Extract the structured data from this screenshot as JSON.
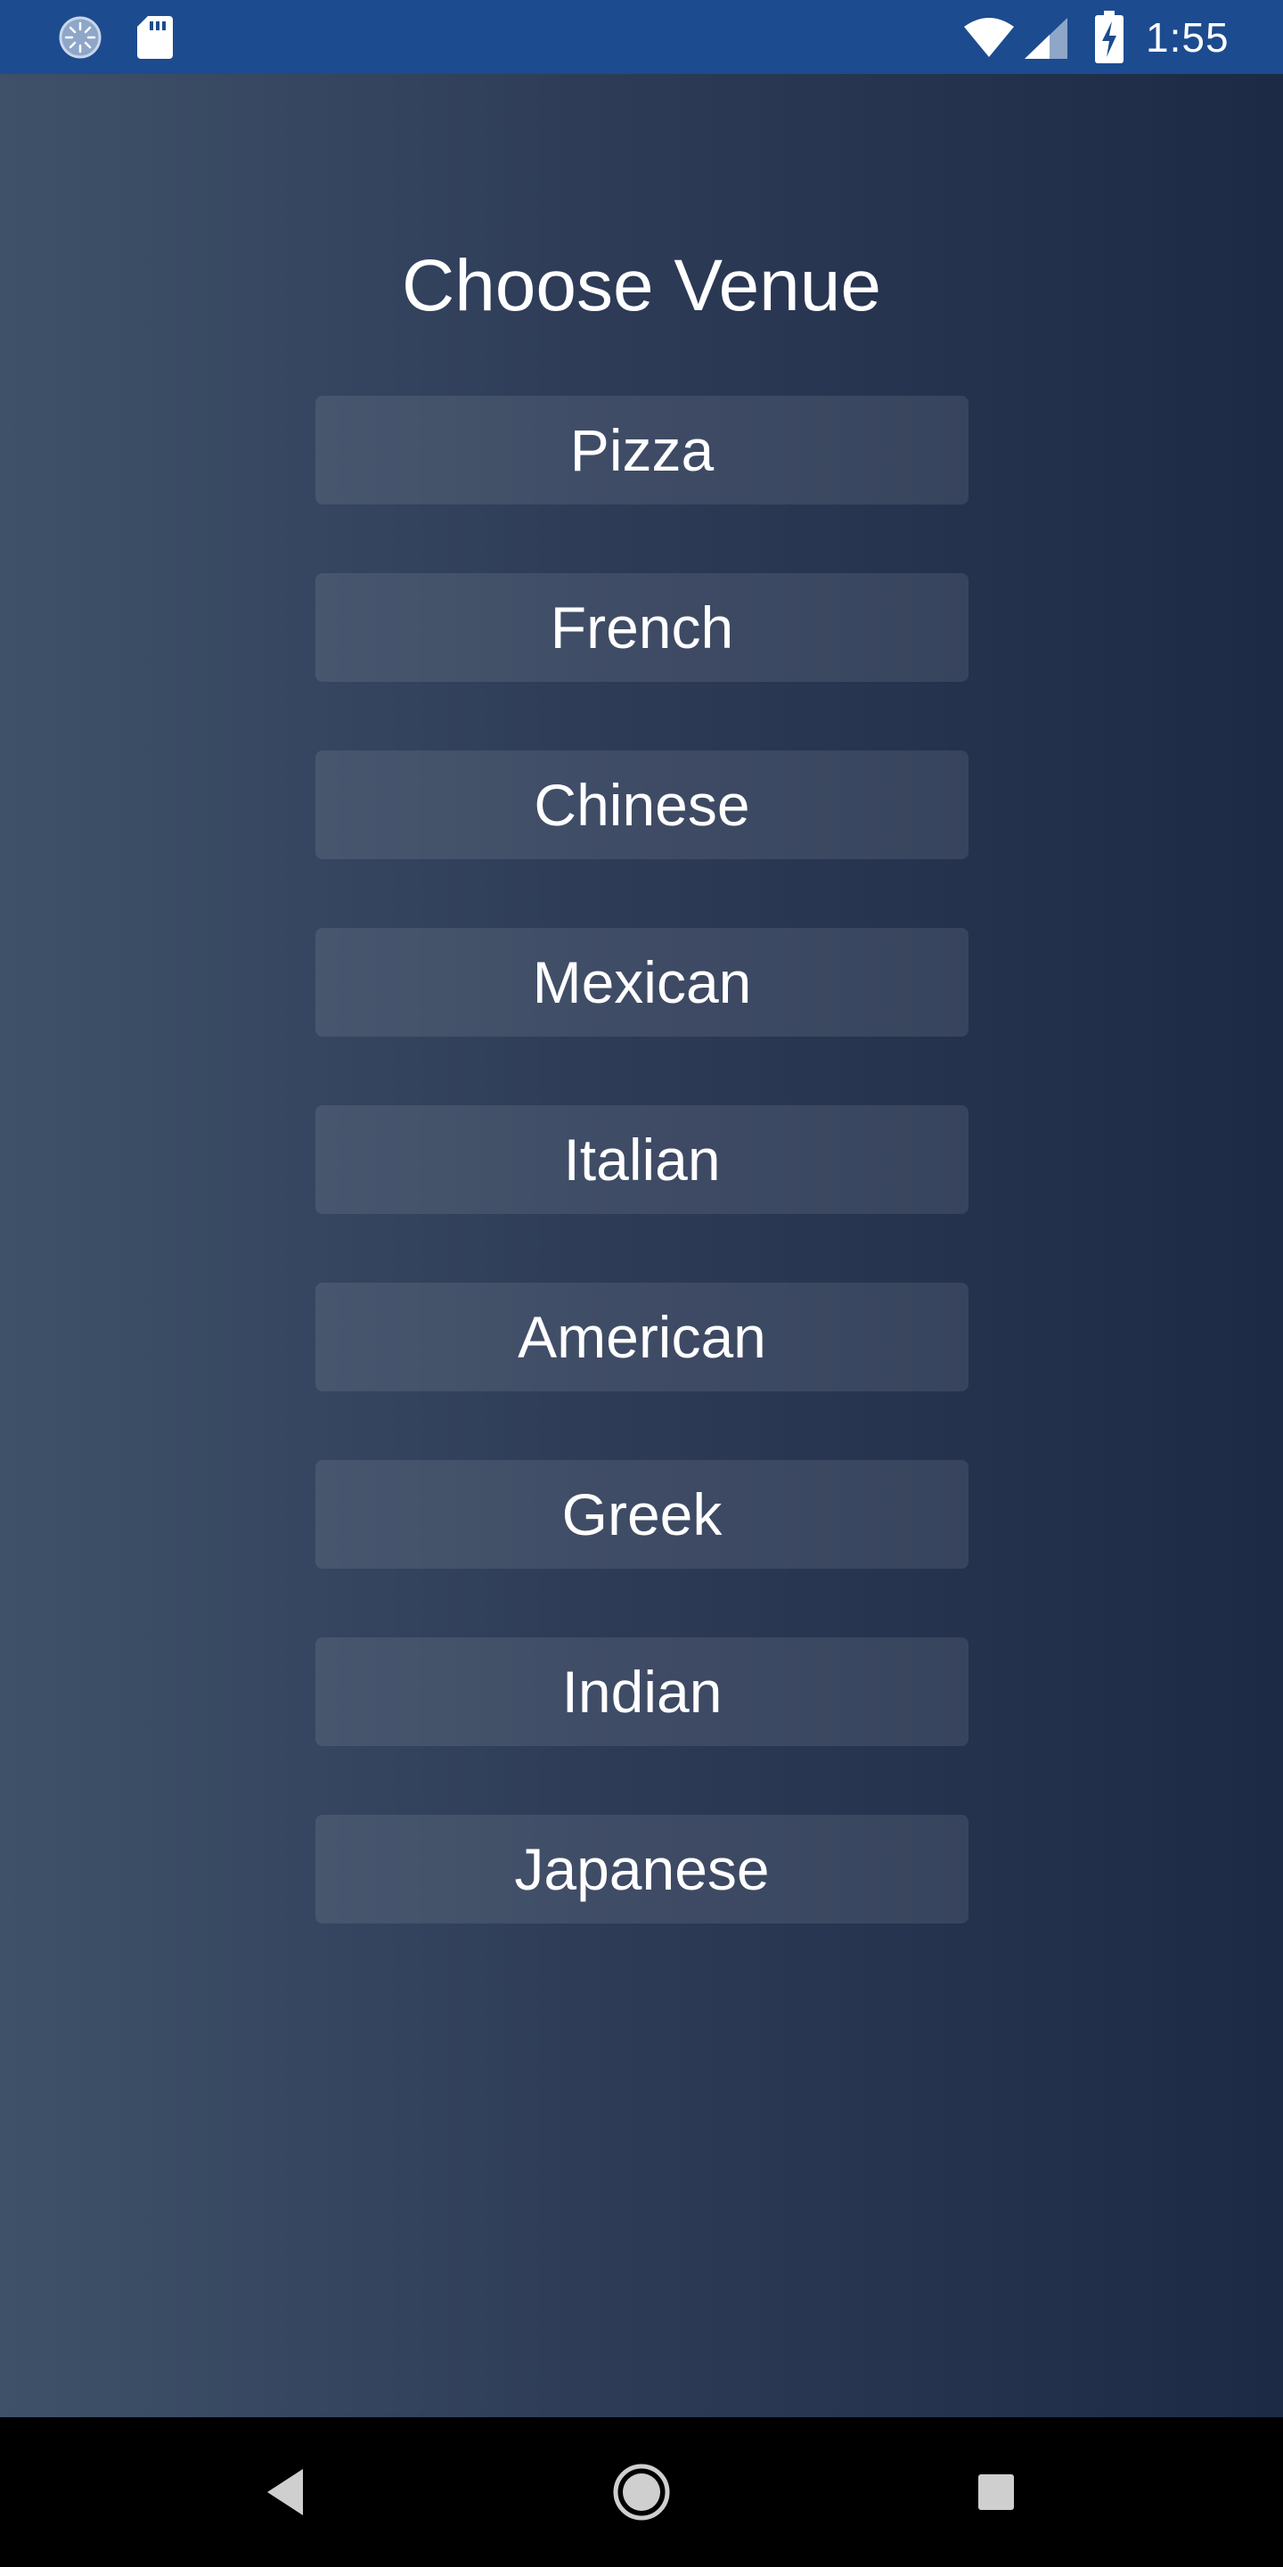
{
  "status_bar": {
    "time": "1:55",
    "icons": [
      "sync-icon",
      "sd-card-icon",
      "wifi-icon",
      "cell-signal-icon",
      "battery-charging-icon"
    ],
    "background_color": "#1c4b8f"
  },
  "screen": {
    "title": "Choose Venue",
    "background_gradient": [
      "#3f5169",
      "#2e3c58",
      "#1c2a45"
    ]
  },
  "venues": [
    {
      "label": "Pizza"
    },
    {
      "label": "French"
    },
    {
      "label": "Chinese"
    },
    {
      "label": "Mexican"
    },
    {
      "label": "Italian"
    },
    {
      "label": "American"
    },
    {
      "label": "Greek"
    },
    {
      "label": "Indian"
    },
    {
      "label": "Japanese"
    }
  ],
  "nav_bar": {
    "icons": [
      "back-icon",
      "home-icon",
      "recents-icon"
    ]
  }
}
